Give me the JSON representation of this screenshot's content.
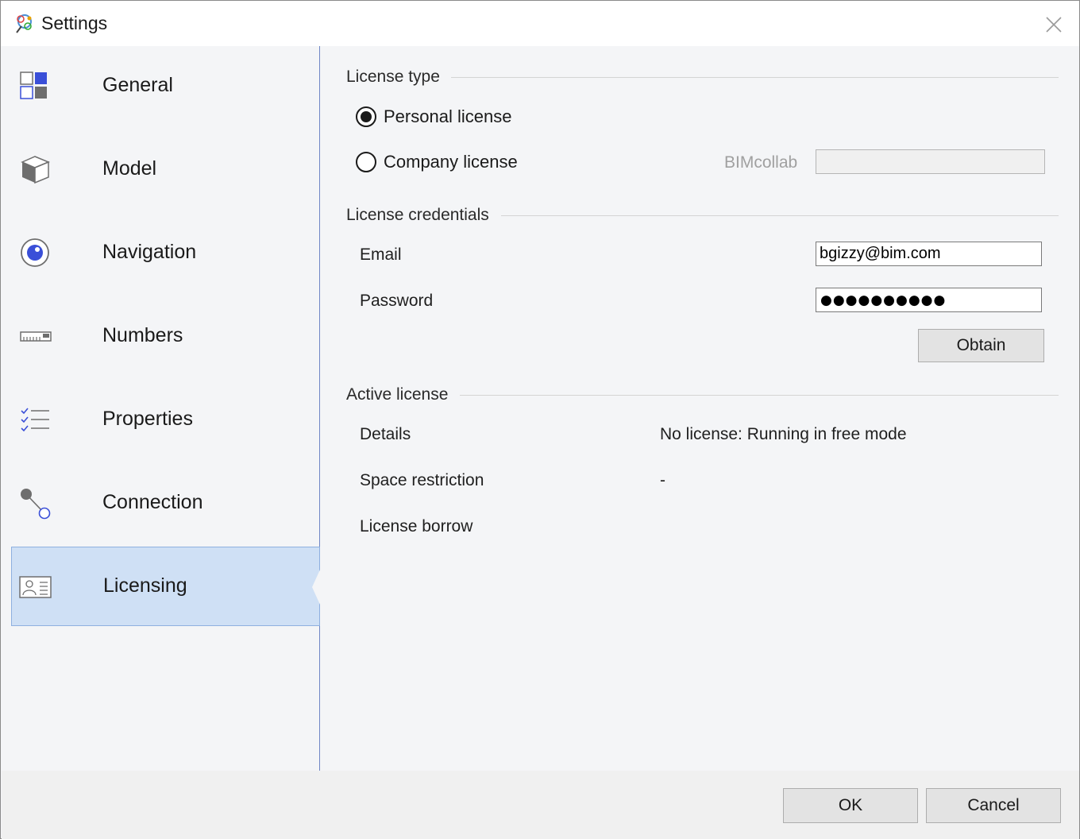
{
  "window": {
    "title": "Settings"
  },
  "sidebar": {
    "items": [
      {
        "id": "general",
        "label": "General"
      },
      {
        "id": "model",
        "label": "Model"
      },
      {
        "id": "navigation",
        "label": "Navigation"
      },
      {
        "id": "numbers",
        "label": "Numbers"
      },
      {
        "id": "properties",
        "label": "Properties"
      },
      {
        "id": "connection",
        "label": "Connection"
      },
      {
        "id": "licensing",
        "label": "Licensing",
        "selected": true
      }
    ]
  },
  "licensing": {
    "license_type": {
      "header": "License type",
      "options": [
        {
          "label": "Personal license",
          "checked": true
        },
        {
          "label": "Company license",
          "checked": false
        }
      ],
      "bimcollab_label": "BIMcollab",
      "bimcollab_value": ""
    },
    "credentials": {
      "header": "License credentials",
      "email_label": "Email",
      "email_value": "bgizzy@bim.com",
      "password_label": "Password",
      "password_mask": "●●●●●●●●●●",
      "obtain_label": "Obtain"
    },
    "active": {
      "header": "Active license",
      "details_label": "Details",
      "details_value": "No license: Running in free mode",
      "space_label": "Space restriction",
      "space_value": "-",
      "borrow_label": "License borrow"
    }
  },
  "footer": {
    "ok_label": "OK",
    "cancel_label": "Cancel"
  },
  "colors": {
    "accent": "#3a4fd8",
    "selection": "#cfe0f5",
    "icon_gray": "#6e6e6e"
  }
}
